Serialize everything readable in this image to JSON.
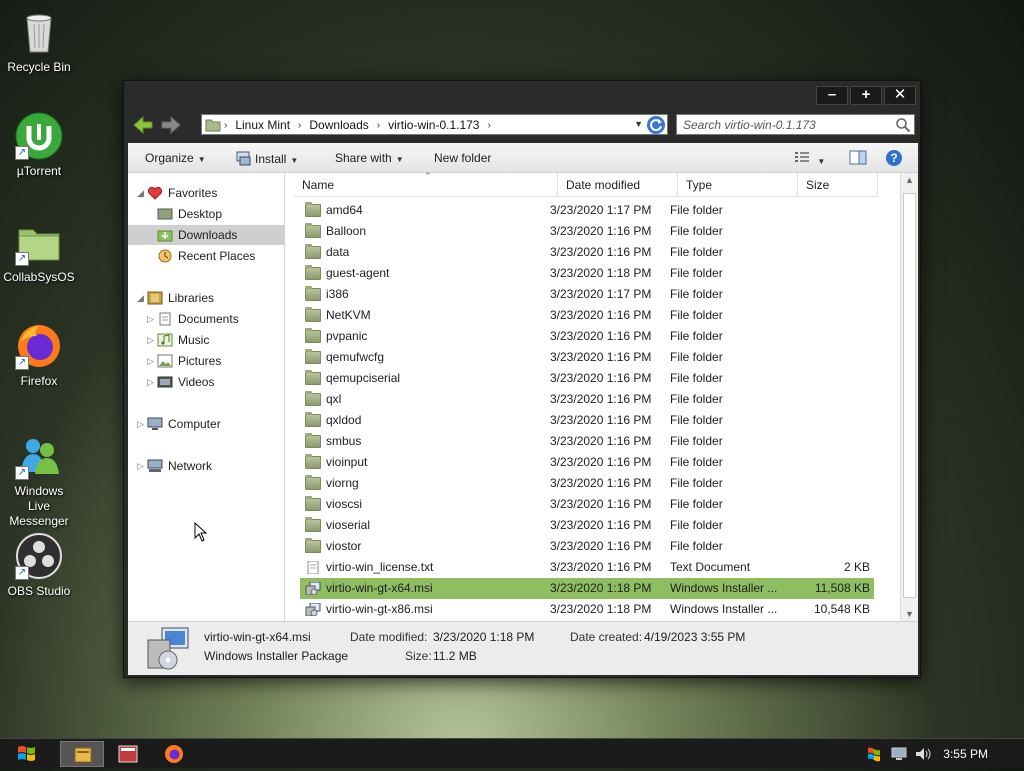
{
  "desktop": {
    "icons": [
      {
        "label": "Recycle Bin",
        "icon": "recycle-bin-icon"
      },
      {
        "label": "µTorrent",
        "icon": "utorrent-icon"
      },
      {
        "label": "CollabSysOS",
        "icon": "folder-icon"
      },
      {
        "label": "Firefox",
        "icon": "firefox-icon"
      },
      {
        "label": "Windows Live Messenger",
        "icon": "messenger-icon"
      },
      {
        "label": "OBS Studio",
        "icon": "obs-icon"
      }
    ]
  },
  "window": {
    "controls": {
      "minimize": "–",
      "maximize": "+",
      "close": "✕"
    },
    "breadcrumbs": [
      "Linux Mint",
      "Downloads",
      "virtio-win-0.1.173"
    ],
    "search_placeholder": "Search virtio-win-0.1.173",
    "toolbar": {
      "organize": "Organize",
      "install": "Install",
      "share_with": "Share with",
      "new_folder": "New folder"
    },
    "nav": {
      "favorites": "Favorites",
      "desktop": "Desktop",
      "downloads": "Downloads",
      "recent_places": "Recent Places",
      "libraries": "Libraries",
      "documents": "Documents",
      "music": "Music",
      "pictures": "Pictures",
      "videos": "Videos",
      "computer": "Computer",
      "network": "Network"
    },
    "columns": {
      "name": "Name",
      "date_modified": "Date modified",
      "type": "Type",
      "size": "Size"
    },
    "files": [
      {
        "name": "amd64",
        "date": "3/23/2020 1:17 PM",
        "type": "File folder",
        "size": "",
        "kind": "folder"
      },
      {
        "name": "Balloon",
        "date": "3/23/2020 1:16 PM",
        "type": "File folder",
        "size": "",
        "kind": "folder"
      },
      {
        "name": "data",
        "date": "3/23/2020 1:16 PM",
        "type": "File folder",
        "size": "",
        "kind": "folder"
      },
      {
        "name": "guest-agent",
        "date": "3/23/2020 1:18 PM",
        "type": "File folder",
        "size": "",
        "kind": "folder"
      },
      {
        "name": "i386",
        "date": "3/23/2020 1:17 PM",
        "type": "File folder",
        "size": "",
        "kind": "folder"
      },
      {
        "name": "NetKVM",
        "date": "3/23/2020 1:16 PM",
        "type": "File folder",
        "size": "",
        "kind": "folder"
      },
      {
        "name": "pvpanic",
        "date": "3/23/2020 1:16 PM",
        "type": "File folder",
        "size": "",
        "kind": "folder"
      },
      {
        "name": "qemufwcfg",
        "date": "3/23/2020 1:16 PM",
        "type": "File folder",
        "size": "",
        "kind": "folder"
      },
      {
        "name": "qemupciserial",
        "date": "3/23/2020 1:16 PM",
        "type": "File folder",
        "size": "",
        "kind": "folder"
      },
      {
        "name": "qxl",
        "date": "3/23/2020 1:16 PM",
        "type": "File folder",
        "size": "",
        "kind": "folder"
      },
      {
        "name": "qxldod",
        "date": "3/23/2020 1:16 PM",
        "type": "File folder",
        "size": "",
        "kind": "folder"
      },
      {
        "name": "smbus",
        "date": "3/23/2020 1:16 PM",
        "type": "File folder",
        "size": "",
        "kind": "folder"
      },
      {
        "name": "vioinput",
        "date": "3/23/2020 1:16 PM",
        "type": "File folder",
        "size": "",
        "kind": "folder"
      },
      {
        "name": "viorng",
        "date": "3/23/2020 1:16 PM",
        "type": "File folder",
        "size": "",
        "kind": "folder"
      },
      {
        "name": "vioscsi",
        "date": "3/23/2020 1:16 PM",
        "type": "File folder",
        "size": "",
        "kind": "folder"
      },
      {
        "name": "vioserial",
        "date": "3/23/2020 1:16 PM",
        "type": "File folder",
        "size": "",
        "kind": "folder"
      },
      {
        "name": "viostor",
        "date": "3/23/2020 1:16 PM",
        "type": "File folder",
        "size": "",
        "kind": "folder"
      },
      {
        "name": "virtio-win_license.txt",
        "date": "3/23/2020 1:16 PM",
        "type": "Text Document",
        "size": "2 KB",
        "kind": "text"
      },
      {
        "name": "virtio-win-gt-x64.msi",
        "date": "3/23/2020 1:18 PM",
        "type": "Windows Installer ...",
        "size": "11,508 KB",
        "kind": "msi",
        "selected": true
      },
      {
        "name": "virtio-win-gt-x86.msi",
        "date": "3/23/2020 1:18 PM",
        "type": "Windows Installer ...",
        "size": "10,548 KB",
        "kind": "msi"
      }
    ],
    "details": {
      "filename": "virtio-win-gt-x64.msi",
      "filetype": "Windows Installer Package",
      "date_modified_label": "Date modified:",
      "date_modified": "3/23/2020 1:18 PM",
      "size_label": "Size:",
      "size": "11.2 MB",
      "date_created_label": "Date created:",
      "date_created": "4/19/2023 3:55 PM"
    }
  },
  "taskbar": {
    "clock": "3:55 PM"
  }
}
